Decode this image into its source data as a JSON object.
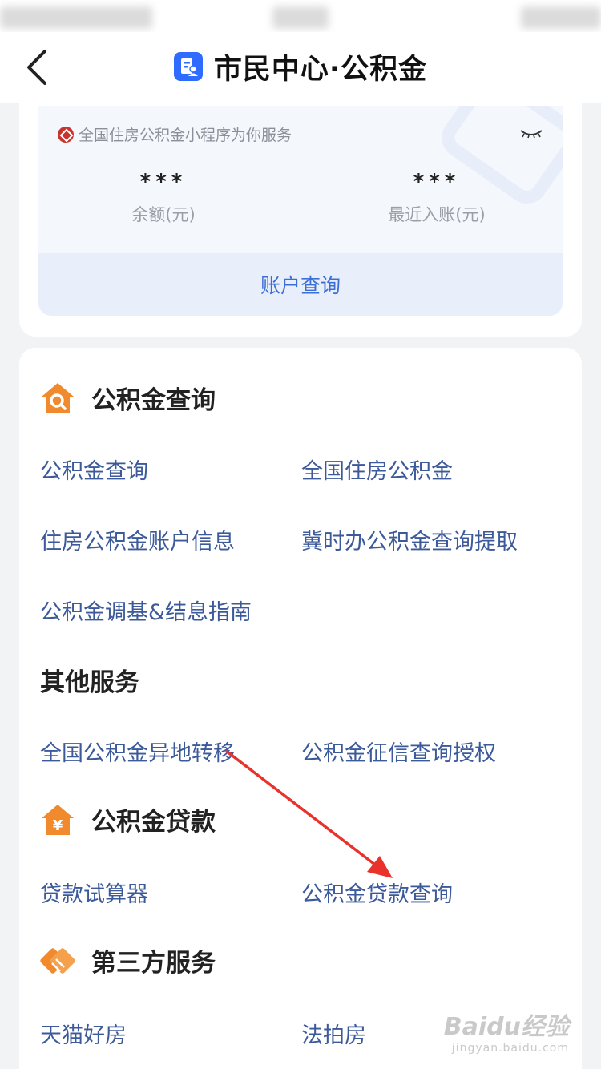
{
  "nav": {
    "title": "市民中心·公积金",
    "back_icon": "chevron-left-icon",
    "logo_icon": "app-logo-icon",
    "brand_color": "#2f6bff"
  },
  "account": {
    "provider": "全国住房公积金小程序为你服务",
    "balance_value": "***",
    "balance_label": "余额(元)",
    "recent_value": "***",
    "recent_label": "最近入账(元)",
    "query_button": "账户查询",
    "toggle_icon": "eye-closed-icon"
  },
  "sections": {
    "query": {
      "title": "公积金查询",
      "icon": "house-search-icon",
      "links": [
        "公积金查询",
        "全国住房公积金",
        "住房公积金账户信息",
        "冀时办公积金查询提取",
        "公积金调基&结息指南"
      ]
    },
    "other": {
      "title": "其他服务",
      "links": [
        "全国公积金异地转移",
        "公积金征信查询授权"
      ]
    },
    "loan": {
      "title": "公积金贷款",
      "icon": "house-yen-icon",
      "links": [
        "贷款试算器",
        "公积金贷款查询"
      ]
    },
    "third": {
      "title": "第三方服务",
      "icon": "handshake-icon",
      "links": [
        "天猫好房",
        "法拍房"
      ]
    }
  },
  "watermark": {
    "main": "Baidu经验",
    "sub": "jingyan.baidu.com"
  },
  "colors": {
    "link": "#3c5a9a",
    "accent_orange": "#f08a2c",
    "annotation_arrow": "#e8322b"
  }
}
